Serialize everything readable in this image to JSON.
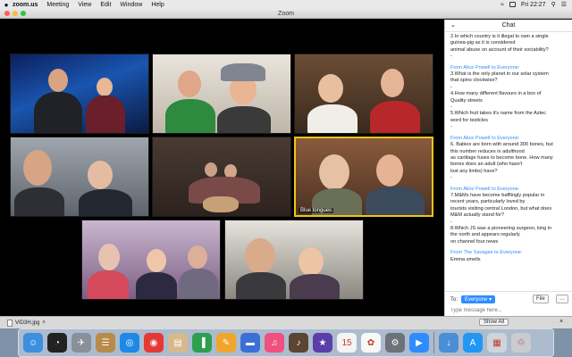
{
  "menubar": {
    "app_name": "zoom.us",
    "menus": [
      "Meeting",
      "View",
      "Edit",
      "Window",
      "Help"
    ],
    "clock": "Fri 22:27"
  },
  "window": {
    "title": "Zoom"
  },
  "gallery": {
    "active_label": "Blue tongues"
  },
  "chat": {
    "title": "Chat",
    "messages": [
      {
        "type": "text",
        "text": "2.In which country is it illegal to own a single\nguinea-pig as it is considered\nanimal abuse on account of their sociability?\n-"
      },
      {
        "type": "from",
        "sender": "Alice Powell",
        "to": "Everyone:"
      },
      {
        "type": "text",
        "text": "3.What is the only planet in our solar system\nthat spins clockwise?\n-"
      },
      {
        "type": "text",
        "text": "4.How many different flavours in a box of\nQuality streets\n-"
      },
      {
        "type": "text",
        "text": "5.Which fruit takes it's name from the Aztec\nword for testicles\n-"
      },
      {
        "type": "from",
        "sender": "Alice Powell",
        "to": "Everyone:"
      },
      {
        "type": "text",
        "text": "6. Babies are born with around 300 bones, but\nthis number reduces in adulthood\nas cartilage fuses to become bone. How many\nbones does an adult (who hasn't\nlost any limbs) have?\n-"
      },
      {
        "type": "from",
        "sender": "Alice Powell",
        "to": "Everyone:"
      },
      {
        "type": "text",
        "text": "7.M&Ms have become bafflingly popular in\nrecent years, particularly loved by\ntourists visiting central London, but what does\nM&M actually stand for?\n-"
      },
      {
        "type": "text",
        "text": "8.Which JS was a pioneering surgeon, king in\nthe north and appears regularly\non channel four news"
      },
      {
        "type": "from",
        "sender": "The Savages",
        "to": "Everyone:"
      },
      {
        "type": "text",
        "text": "Emma smells"
      }
    ],
    "from_prefix": "From",
    "to_word": "to",
    "to_label": "To:",
    "to_value": "Everyone",
    "file_label": "File",
    "more_label": "…",
    "input_placeholder": "Type message here..."
  },
  "downloads": {
    "file_name": "VID3H.jpg",
    "show_all": "Show All",
    "close": "×"
  },
  "dock": {
    "apps": [
      {
        "name": "finder-icon",
        "color": "#3d8fe0",
        "glyph": "☺"
      },
      {
        "name": "dashboard-icon",
        "color": "#222222",
        "glyph": "◔"
      },
      {
        "name": "launchpad-icon",
        "color": "#8a8f98",
        "glyph": "✈"
      },
      {
        "name": "notes-app-icon",
        "color": "#b98b4b",
        "glyph": "☰"
      },
      {
        "name": "safari-icon",
        "color": "#1e88e5",
        "glyph": "◎"
      },
      {
        "name": "chrome-icon",
        "color": "#e53935",
        "glyph": "◉"
      },
      {
        "name": "preview-icon",
        "color": "#d7b98a",
        "glyph": "▤"
      },
      {
        "name": "numbers-icon",
        "color": "#2e9e4f",
        "glyph": "▐"
      },
      {
        "name": "pages-icon",
        "color": "#f2a52b",
        "glyph": "✎"
      },
      {
        "name": "keynote-icon",
        "color": "#3a6fd8",
        "glyph": "▬"
      },
      {
        "name": "music-icon",
        "color": "#f05080",
        "glyph": "♫"
      },
      {
        "name": "garageband-icon",
        "color": "#5a4532",
        "glyph": "♪"
      },
      {
        "name": "imovie-icon",
        "color": "#5b3fa8",
        "glyph": "★"
      },
      {
        "name": "calendar-icon",
        "color": "#f4f4f4",
        "glyph": "15"
      },
      {
        "name": "photos-icon",
        "color": "#f7f7f7",
        "glyph": "✿"
      },
      {
        "name": "system-preferences-icon",
        "color": "#6c727a",
        "glyph": "⚙"
      },
      {
        "name": "zoom-icon",
        "color": "#2d8cff",
        "glyph": "▶"
      },
      {
        "name": "downloads-folder-icon",
        "color": "#4a8fd6",
        "glyph": "↓"
      },
      {
        "name": "app-store-icon",
        "color": "#2196f3",
        "glyph": "A"
      },
      {
        "name": "file-stack-icon",
        "color": "#cfd4da",
        "glyph": "▦"
      },
      {
        "name": "trash-icon",
        "color": "#c8ccd1",
        "glyph": "♲"
      }
    ]
  }
}
